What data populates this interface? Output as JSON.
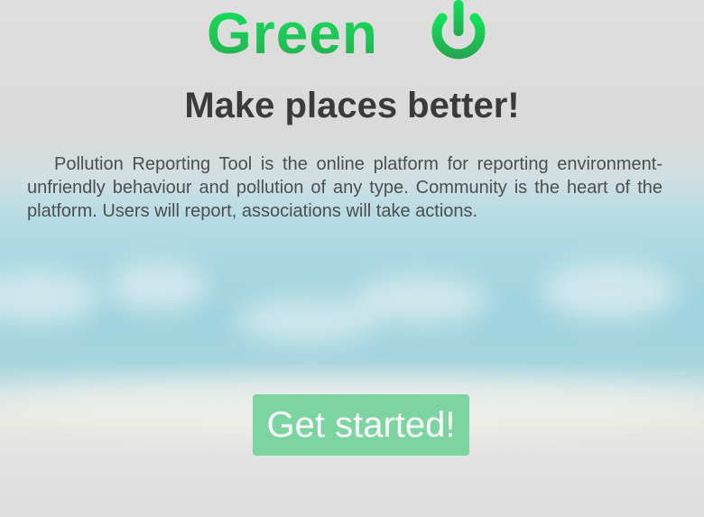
{
  "brand": {
    "logo_text": "Green",
    "logo_icon": "power-icon"
  },
  "hero": {
    "heading": "Make places better!",
    "description": "Pollution Reporting Tool is the online platform for reporting environment-unfriendly behaviour and pollution of any type. Community is the heart of the platform. Users will report, associations will take actions."
  },
  "cta": {
    "label": "Get started!"
  },
  "colors": {
    "brand_green": "#1ec455",
    "button": "#7cd4a1",
    "heading_text": "#3a3b3a",
    "body_text": "#4d4e4d",
    "sky": "#a8d7e2"
  }
}
